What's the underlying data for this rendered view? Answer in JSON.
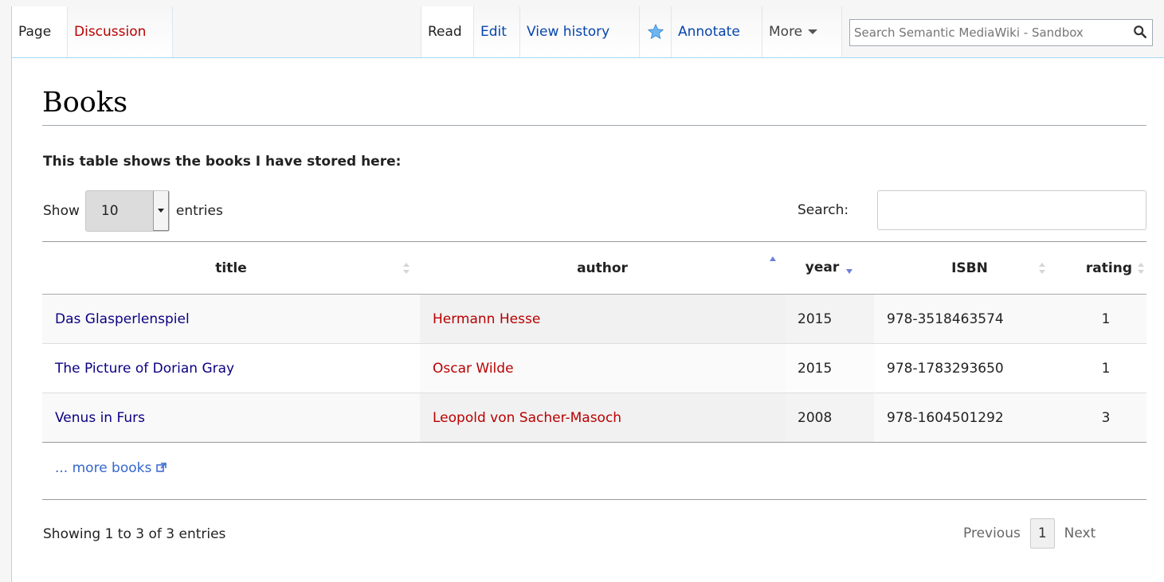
{
  "tabs": {
    "page": "Page",
    "discussion": "Discussion",
    "read": "Read",
    "edit": "Edit",
    "view_history": "View history",
    "annotate": "Annotate",
    "more": "More"
  },
  "site_search": {
    "placeholder": "Search Semantic MediaWiki - Sandbox"
  },
  "page": {
    "title": "Books",
    "intro": "This table shows the books I have stored here:"
  },
  "table_controls": {
    "show_label": "Show",
    "entries_value": "10",
    "entries_label": "entries",
    "search_label": "Search:"
  },
  "table": {
    "columns": [
      "title",
      "author",
      "year",
      "ISBN",
      "rating"
    ],
    "rows": [
      {
        "title": "Das Glasperlenspiel",
        "author": "Hermann Hesse",
        "year": "2015",
        "isbn": "978-3518463574",
        "rating": "1"
      },
      {
        "title": "The Picture of Dorian Gray",
        "author": "Oscar Wilde",
        "year": "2015",
        "isbn": "978-1783293650",
        "rating": "1"
      },
      {
        "title": "Venus in Furs",
        "author": "Leopold von Sacher-Masoch",
        "year": "2008",
        "isbn": "978-1604501292",
        "rating": "3"
      }
    ]
  },
  "more_link": "... more books",
  "footer": {
    "info": "Showing 1 to 3 of 3 entries",
    "previous": "Previous",
    "current_page": "1",
    "next": "Next"
  },
  "colors": {
    "link": "#0b0080",
    "redlink": "#ba0000",
    "external_link": "#3366cc",
    "sort_active": "#6d7fd8",
    "sort_inactive": "#d5d5d5"
  }
}
